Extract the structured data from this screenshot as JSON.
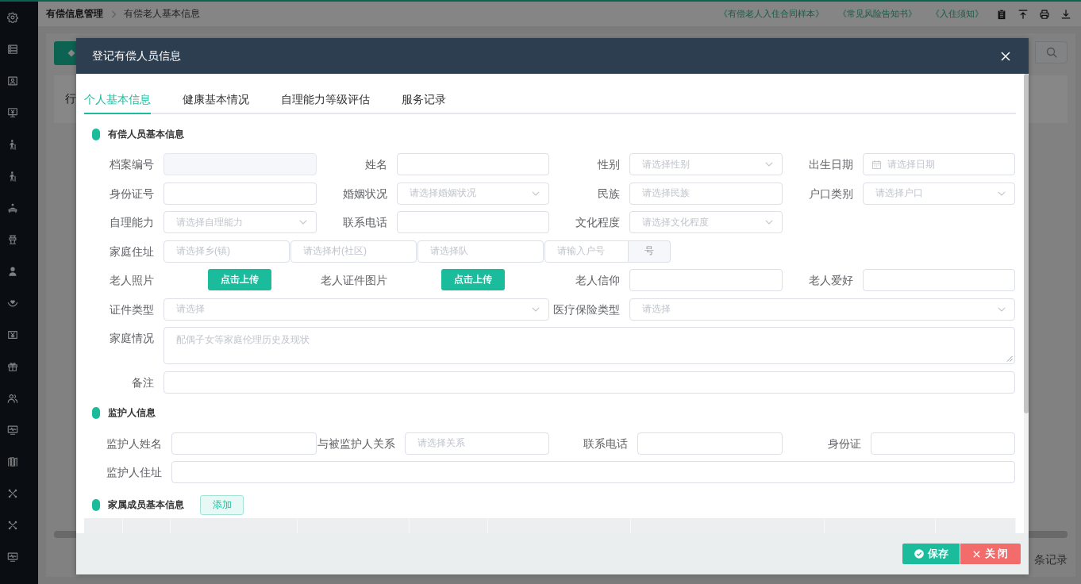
{
  "topbar": {
    "breadcrumb": [
      "有偿信息管理",
      "有偿老人基本信息"
    ],
    "links": [
      "《有偿老人入住合同样本》",
      "《常见风险告知书》",
      "《入住须知》"
    ]
  },
  "page_table": {
    "columns": [
      "行"
    ],
    "record_count": "条记录"
  },
  "dialog": {
    "title": "登记有偿人员信息",
    "tabs": [
      {
        "label": "个人基本信息",
        "selected": true
      },
      {
        "label": "健康基本情况",
        "selected": false
      },
      {
        "label": "自理能力等级评估",
        "selected": false
      },
      {
        "label": "服务记录",
        "selected": false
      }
    ],
    "sections": [
      {
        "title": "有偿人员基本信息",
        "kind": "form",
        "rows": [
          [
            {
              "label": "档案编号",
              "kind": "readonly"
            },
            {
              "label": "姓名",
              "kind": "input"
            },
            {
              "label": "性别",
              "kind": "select",
              "placeholder": "请选择性别"
            },
            {
              "label": "出生日期",
              "kind": "date",
              "placeholder": "请选择日期"
            }
          ],
          [
            {
              "label": "身份证号",
              "kind": "input"
            },
            {
              "label": "婚姻状况",
              "kind": "select",
              "placeholder": "请选择婚姻状况"
            },
            {
              "label": "民族",
              "kind": "input",
              "placeholder": "请选择民族"
            },
            {
              "label": "户口类别",
              "kind": "select",
              "placeholder": "请选择户口"
            }
          ],
          [
            {
              "label": "自理能力",
              "kind": "select",
              "placeholder": "请选择自理能力"
            },
            {
              "label": "联系电话",
              "kind": "input"
            },
            {
              "label": "文化程度",
              "kind": "select",
              "placeholder": "请选择文化程度"
            }
          ],
          [
            {
              "label": "家庭住址",
              "kind": "address",
              "parts": [
                {
                  "placeholder": "请选择乡(镇)"
                },
                {
                  "placeholder": "请选择村(社区)"
                },
                {
                  "placeholder": "请选择队"
                },
                {
                  "placeholder": "请输入户号",
                  "append": "号"
                }
              ]
            },
            "",
            "",
            ""
          ],
          [
            {
              "label": "老人照片",
              "kind": "upload",
              "button": "点击上传"
            },
            {
              "label": "老人证件图片",
              "kind": "upload",
              "button": "点击上传"
            },
            {
              "label": "老人信仰",
              "kind": "input"
            },
            {
              "label": "老人爱好",
              "kind": "input"
            }
          ],
          [
            {
              "label": "证件类型",
              "kind": "select",
              "placeholder": "请选择"
            },
            "",
            {
              "label": "医疗保险类型",
              "kind": "select",
              "placeholder": "请选择"
            },
            ""
          ],
          [
            {
              "label": "家庭情况",
              "kind": "textarea",
              "placeholder": "配偶子女等家庭伦理历史及现状"
            },
            "",
            "",
            ""
          ],
          [
            {
              "label": "备注",
              "kind": "input"
            },
            "",
            "",
            ""
          ]
        ]
      },
      {
        "title": "监护人信息",
        "kind": "form",
        "rows": [
          [
            {
              "label": "监护人姓名",
              "kind": "input"
            },
            {
              "label": "与被监护人关系",
              "kind": "input",
              "placeholder": "请选择关系"
            },
            {
              "label": "联系电话",
              "kind": "input"
            },
            {
              "label": "身份证",
              "kind": "input"
            }
          ],
          [
            {
              "label": "监护人住址",
              "kind": "input"
            },
            "",
            "",
            ""
          ]
        ]
      },
      {
        "title": "家属成员基本信息",
        "kind": "table",
        "action": "添加"
      }
    ],
    "buttons": [
      {
        "label": "保存",
        "kind": "primary"
      },
      {
        "label": "关 闭",
        "kind": "danger"
      }
    ]
  }
}
